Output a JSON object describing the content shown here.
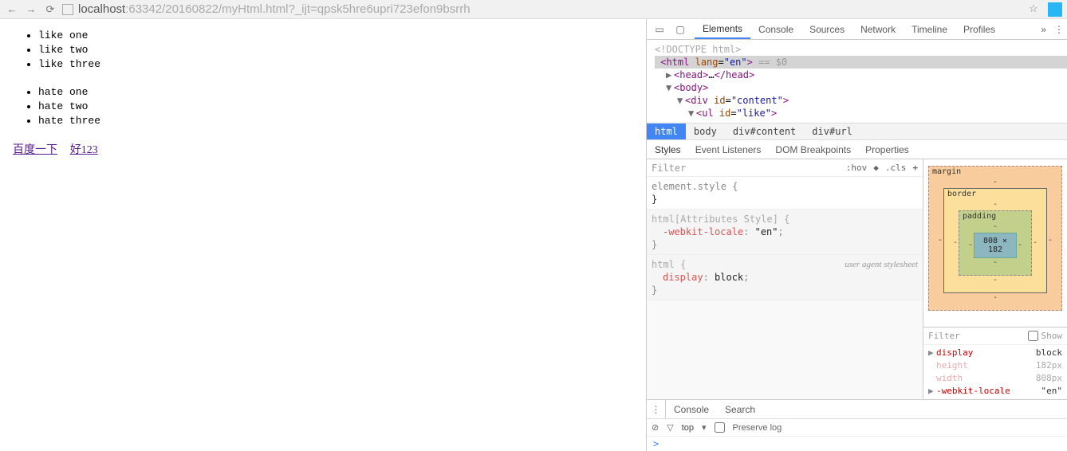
{
  "browser": {
    "url_prefix": "localhost",
    "url_rest": ":63342/20160822/myHtml.html?_ijt=qpsk5hre6upri723efon9bsrrh"
  },
  "page": {
    "like_items": [
      "like one",
      "like two",
      "like three"
    ],
    "hate_items": [
      "hate one",
      "hate two",
      "hate three"
    ],
    "links": [
      {
        "label": "百度一下"
      },
      {
        "label": "好123"
      }
    ]
  },
  "devtools": {
    "tabs": [
      "Elements",
      "Console",
      "Sources",
      "Network",
      "Timeline",
      "Profiles"
    ],
    "active_tab": "Elements",
    "dom": {
      "doctype": "<!DOCTYPE html>",
      "html_open": "<html lang=\"en\">",
      "eq0": "== $0",
      "head": "<head>…</head>",
      "body": "<body>",
      "div": "<div id=\"content\">",
      "ul": "<ul id=\"like\">"
    },
    "crumbs": [
      "html",
      "body",
      "div#content",
      "div#url"
    ],
    "styles_tabs": [
      "Styles",
      "Event Listeners",
      "DOM Breakpoints",
      "Properties"
    ],
    "filter_label": "Filter",
    "hov_label": ":hov",
    "cls_label": ".cls",
    "rules": {
      "element_style": "element.style {",
      "html_attr": "html[Attributes Style] {",
      "webkit_locale": "-webkit-locale",
      "webkit_locale_val": "\"en\"",
      "html_sel": "html {",
      "display": "display",
      "display_val": "block",
      "ua_label": "user agent stylesheet",
      "close": "}"
    },
    "boxmodel": {
      "margin": "margin",
      "border": "border",
      "padding": "padding",
      "content": "808 × 182",
      "dash": "-"
    },
    "computed": {
      "filter": "Filter",
      "show_label": "Show",
      "props": [
        {
          "name": "display",
          "value": "block",
          "dim": false,
          "tri": true
        },
        {
          "name": "height",
          "value": "182px",
          "dim": true,
          "tri": false
        },
        {
          "name": "width",
          "value": "808px",
          "dim": true,
          "tri": false
        },
        {
          "name": "-webkit-locale",
          "value": "\"en\"",
          "dim": false,
          "tri": true
        }
      ]
    },
    "drawer": {
      "tabs": [
        "Console",
        "Search"
      ],
      "top": "top",
      "preserve": "Preserve log",
      "prompt": ">"
    }
  }
}
